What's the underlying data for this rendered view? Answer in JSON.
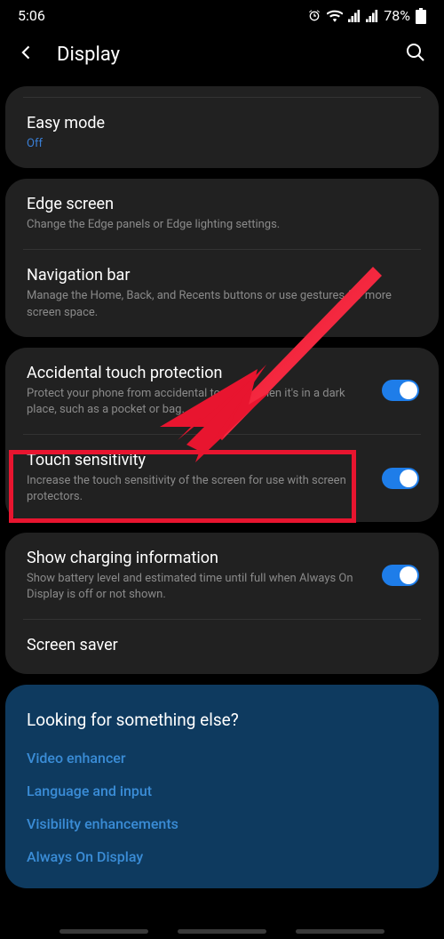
{
  "status": {
    "time": "5:06",
    "battery": "78%"
  },
  "header": {
    "title": "Display"
  },
  "groups": [
    {
      "items": [
        {
          "title": "Easy mode",
          "sub": "Off",
          "subBlue": true
        }
      ]
    },
    {
      "items": [
        {
          "title": "Edge screen",
          "sub": "Change the Edge panels or Edge lighting settings."
        },
        {
          "title": "Navigation bar",
          "sub": "Manage the Home, Back, and Recents buttons or use gestures for more screen space."
        }
      ]
    },
    {
      "items": [
        {
          "title": "Accidental touch protection",
          "sub": "Protect your phone from accidental touches when it's in a dark place, such as a pocket or bag.",
          "toggle": true
        },
        {
          "title": "Touch sensitivity",
          "sub": "Increase the touch sensitivity of the screen for use with screen protectors.",
          "toggle": true
        }
      ]
    },
    {
      "items": [
        {
          "title": "Show charging information",
          "sub": "Show battery level and estimated time until full when Always On Display is off or not shown.",
          "toggle": true
        },
        {
          "title": "Screen saver"
        }
      ]
    }
  ],
  "help": {
    "title": "Looking for something else?",
    "links": [
      "Video enhancer",
      "Language and input",
      "Visibility enhancements",
      "Always On Display"
    ]
  }
}
